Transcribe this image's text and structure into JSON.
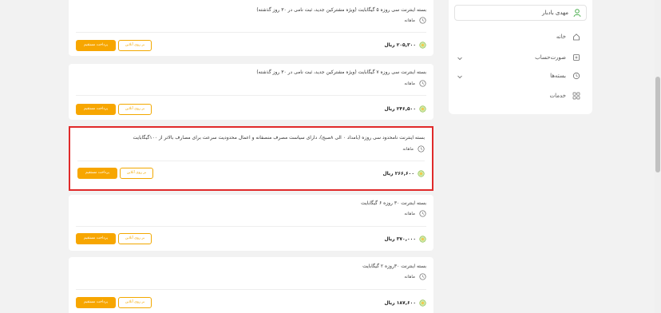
{
  "sidebar": {
    "user_name": "مهدی بادبار",
    "items": [
      {
        "label": "خانه",
        "icon": "home-icon",
        "expandable": false
      },
      {
        "label": "صورت‌حساب",
        "icon": "invoice-icon",
        "expandable": true
      },
      {
        "label": "بسته‌ها",
        "icon": "package-icon",
        "expandable": true
      },
      {
        "label": "خدمات",
        "icon": "services-icon",
        "expandable": false
      }
    ]
  },
  "packages": [
    {
      "title": "بسته اینترنت سی روزه ۵ گیگابایت (ویژه مشترکین جدید، ثبت نامی در ۳۰ روز گذشته)",
      "period": "ماهانه",
      "price": "۲۰۵,۳۰۰ ریال",
      "gift_label": "بر روی آنلاین",
      "buy_label": "پرداخت مستقیم",
      "highlighted": false
    },
    {
      "title": "بسته اینترنت سی روزه ۷ گیگابایت (ویژه مشترکین جدید، ثبت نامی در ۳۰ روز گذشته)",
      "period": "ماهانه",
      "price": "۲۴۶,۵۰۰ ریال",
      "gift_label": "بر روی آنلاین",
      "buy_label": "پرداخت مستقیم",
      "highlighted": false
    },
    {
      "title": "بسته اینترنت نامحدود سی روزه (بامداد ۰ الی ۸صبح)، دارای سیاست مصرف منصفانه و اعمال محدودیت سرعت برای مصارف بالاتر از ۱۰۰گیگابایت",
      "period": "ماهانه",
      "price": "۲۶۶,۶۰۰ ریال",
      "gift_label": "بر روی آنلاین",
      "buy_label": "پرداخت مستقیم",
      "highlighted": true
    },
    {
      "title": "بسته اینترنت ۳۰ روزه ۶ گیگابایت",
      "period": "ماهانه",
      "price": "۳۷۰,۰۰۰ ریال",
      "gift_label": "بر روی آنلاین",
      "buy_label": "پرداخت مستقیم",
      "highlighted": false
    },
    {
      "title": "بسته اینترنت ۳۰روزه ۲ گیگابایت",
      "period": "ماهانه",
      "price": "۱۸۷,۶۰۰ ریال",
      "gift_label": "بر روی آنلاین",
      "buy_label": "پرداخت مستقیم",
      "highlighted": false
    }
  ],
  "colors": {
    "accent": "#f7a600",
    "highlight_border": "#e02a2a",
    "background": "#f2f2f2",
    "card": "#ffffff"
  }
}
